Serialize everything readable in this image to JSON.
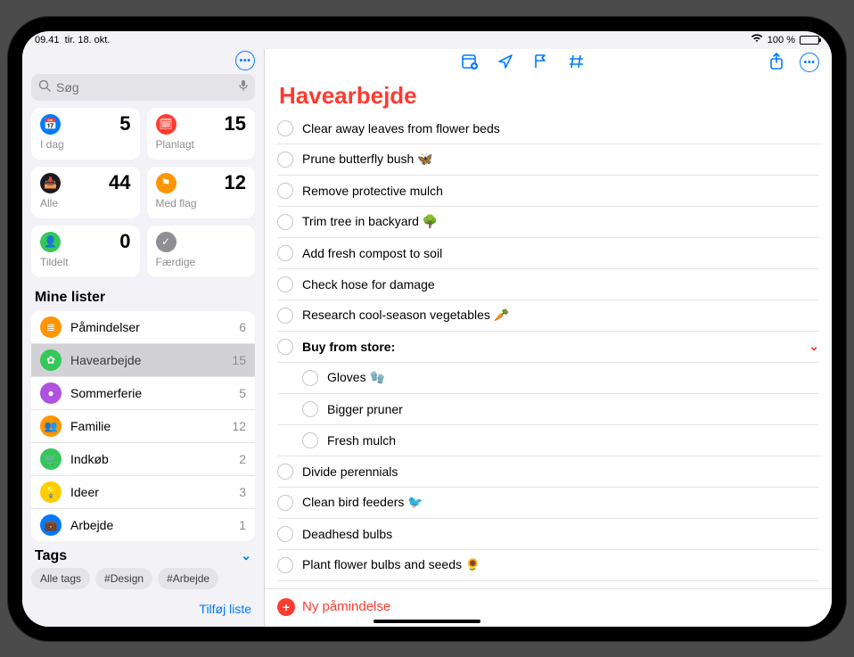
{
  "status": {
    "time": "09.41",
    "date": "tir. 18. okt.",
    "battery": "100 %"
  },
  "search": {
    "placeholder": "Søg"
  },
  "smart": [
    {
      "label": "I dag",
      "count": "5",
      "color": "ic-blue",
      "glyph": "📅"
    },
    {
      "label": "Planlagt",
      "count": "15",
      "color": "ic-red",
      "glyph": "🗓"
    },
    {
      "label": "Alle",
      "count": "44",
      "color": "ic-dark",
      "glyph": "📥"
    },
    {
      "label": "Med flag",
      "count": "12",
      "color": "ic-orange",
      "glyph": "⚑"
    },
    {
      "label": "Tildelt",
      "count": "0",
      "color": "ic-green",
      "glyph": "👤"
    },
    {
      "label": "Færdige",
      "count": "",
      "color": "ic-gray",
      "glyph": "✓"
    }
  ],
  "sectionMyLists": "Mine lister",
  "lists": [
    {
      "name": "Påmindelser",
      "count": "6",
      "color": "li-orange",
      "glyph": "≣",
      "selected": false
    },
    {
      "name": "Havearbejde",
      "count": "15",
      "color": "li-green",
      "glyph": "✿",
      "selected": true
    },
    {
      "name": "Sommerferie",
      "count": "5",
      "color": "li-purple",
      "glyph": "●",
      "selected": false
    },
    {
      "name": "Familie",
      "count": "12",
      "color": "li-orange",
      "glyph": "👥",
      "selected": false
    },
    {
      "name": "Indkøb",
      "count": "2",
      "color": "li-green",
      "glyph": "🛒",
      "selected": false
    },
    {
      "name": "Ideer",
      "count": "3",
      "color": "li-yellow",
      "glyph": "💡",
      "selected": false
    },
    {
      "name": "Arbejde",
      "count": "1",
      "color": "li-blue",
      "glyph": "💼",
      "selected": false
    }
  ],
  "tags": {
    "title": "Tags",
    "items": [
      "Alle tags",
      "#Design",
      "#Arbejde"
    ]
  },
  "addList": "Tilføj liste",
  "main": {
    "title": "Havearbejde",
    "newReminder": "Ny påmindelse",
    "items": [
      {
        "text": "Clear away leaves from flower beds",
        "sub": false
      },
      {
        "text": "Prune butterfly bush 🦋",
        "sub": false
      },
      {
        "text": "Remove protective mulch",
        "sub": false
      },
      {
        "text": "Trim tree in backyard 🌳",
        "sub": false
      },
      {
        "text": "Add fresh compost to soil",
        "sub": false
      },
      {
        "text": "Check hose for damage",
        "sub": false
      },
      {
        "text": "Research cool-season vegetables 🥕",
        "sub": false
      },
      {
        "text": "Buy from store:",
        "sub": false,
        "bold": true,
        "expand": true
      },
      {
        "text": "Gloves 🧤",
        "sub": true
      },
      {
        "text": "Bigger pruner",
        "sub": true
      },
      {
        "text": "Fresh mulch",
        "sub": true
      },
      {
        "text": "Divide perennials",
        "sub": false
      },
      {
        "text": "Clean bird feeders 🐦",
        "sub": false
      },
      {
        "text": "Deadhesd bulbs",
        "sub": false
      },
      {
        "text": "Plant flower bulbs and seeds 🌻",
        "sub": false
      }
    ]
  }
}
